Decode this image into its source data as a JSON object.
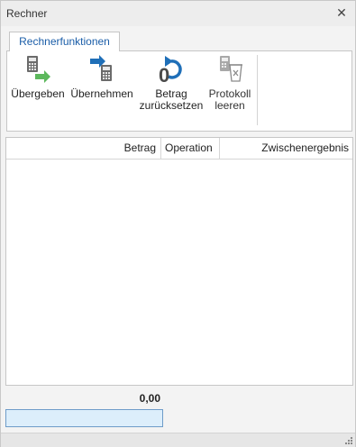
{
  "window": {
    "title": "Rechner",
    "close_glyph": "✕"
  },
  "ribbon": {
    "tab_label": "Rechnerfunktionen",
    "buttons": [
      {
        "label": "Übergeben",
        "icon": "calculator-pass-icon",
        "enabled": true
      },
      {
        "label": "Übernehmen",
        "icon": "calculator-take-icon",
        "enabled": true
      },
      {
        "label": "Betrag\nzurücksetzen",
        "label_line1": "Betrag",
        "label_line2": "zurücksetzen",
        "icon": "reset-zero-icon",
        "enabled": true
      },
      {
        "label": "Protokoll\nleeren",
        "label_line1": "Protokoll",
        "label_line2": "leeren",
        "icon": "clear-protocol-icon",
        "enabled": false
      }
    ]
  },
  "grid": {
    "columns": [
      "Betrag",
      "Operation",
      "Zwischenergebnis"
    ],
    "rows": []
  },
  "footer": {
    "result": "0,00",
    "input_value": ""
  },
  "colors": {
    "accent": "#1a5da8",
    "green_arrow": "#5cb85c",
    "blue_arrow": "#1f6fb8",
    "input_bg": "#dceefb"
  }
}
